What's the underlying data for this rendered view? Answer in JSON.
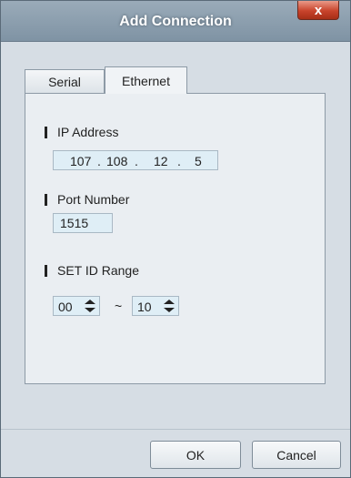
{
  "window": {
    "title": "Add Connection",
    "close_label": "x"
  },
  "tabs": [
    {
      "label": "Serial",
      "selected": false
    },
    {
      "label": "Ethernet",
      "selected": true
    }
  ],
  "ip": {
    "label": "IP Address",
    "octets": [
      "107",
      "108",
      "12",
      "5"
    ]
  },
  "port": {
    "label": "Port Number",
    "value": "1515"
  },
  "set_id_range": {
    "label": "SET ID Range",
    "from": "00",
    "separator": "~",
    "to": "10"
  },
  "buttons": {
    "ok": "OK",
    "cancel": "Cancel"
  },
  "colors": {
    "field_bg": "#dfeef6",
    "panel_bg": "#eaeef2",
    "dialog_bg": "#d6dde4",
    "close_red": "#c8432b"
  }
}
